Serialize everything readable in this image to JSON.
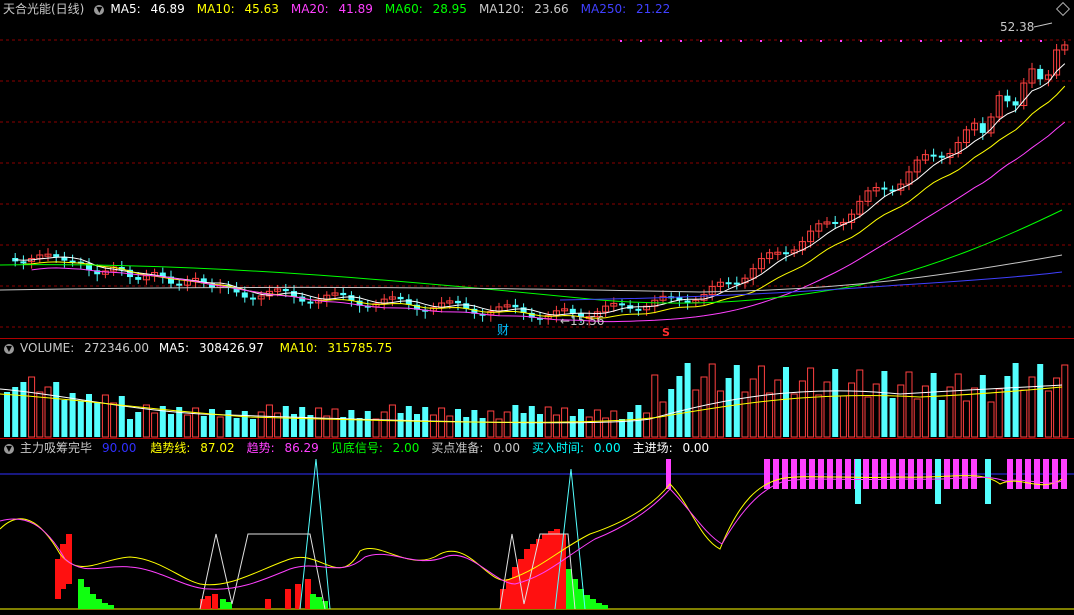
{
  "price": {
    "title": "天合光能(日线)",
    "ma": [
      {
        "label": "MA5:",
        "value": "46.89",
        "color": "#ffffff"
      },
      {
        "label": "MA10:",
        "value": "45.63",
        "color": "#ffff00"
      },
      {
        "label": "MA20:",
        "value": "41.89",
        "color": "#ff40ff"
      },
      {
        "label": "MA60:",
        "value": "28.95",
        "color": "#00ff00"
      },
      {
        "label": "MA120:",
        "value": "23.66",
        "color": "#c8c8c8"
      },
      {
        "label": "MA250:",
        "value": "21.22",
        "color": "#4040ff"
      }
    ],
    "high_label": "52.38",
    "low_label": "15.56",
    "mark_cai": "财",
    "mark_s": "S"
  },
  "volume": {
    "title": "VOLUME:",
    "value": "272346.00",
    "ma5_label": "MA5:",
    "ma5": "308426.97",
    "ma10_label": "MA10:",
    "ma10": "315785.75"
  },
  "indicator": {
    "title": "主力吸筹完毕",
    "title_value": "90.00",
    "items": [
      {
        "label": "趋势线:",
        "value": "87.02",
        "color": "#ffff00"
      },
      {
        "label": "趋势:",
        "value": "86.29",
        "color": "#ff40ff"
      },
      {
        "label": "见底信号:",
        "value": "2.00",
        "color": "#00ff00"
      },
      {
        "label": "买点准备:",
        "value": "0.00",
        "color": "#c8c8c8"
      },
      {
        "label": "买入时间:",
        "value": "0.00",
        "color": "#00ffff"
      },
      {
        "label": "主进场:",
        "value": "0.00",
        "color": "#ffffff"
      }
    ]
  },
  "colors": {
    "up": "#ff4040",
    "down": "#54ffff",
    "grid": "#8b0000",
    "bg": "#000000"
  }
}
